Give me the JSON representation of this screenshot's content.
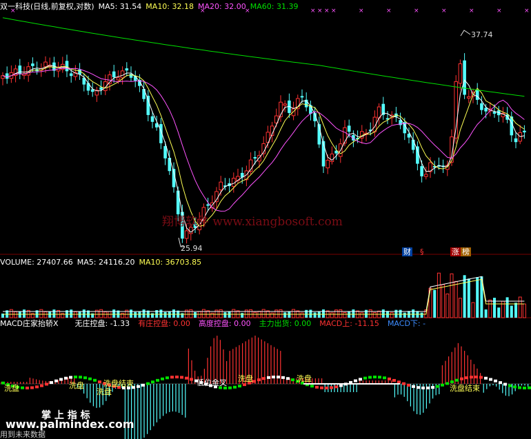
{
  "colors": {
    "up": "#ff3232",
    "down": "#54ffff",
    "ma5": "#ffffff",
    "ma10": "#ffff54",
    "ma20": "#ff54ff",
    "ma60": "#00e000",
    "macd_pos": "#ff3232",
    "macd_neg": "#54ffff",
    "grid": "#7a0000"
  },
  "price_panel": {
    "title": "双一科技(日线,前复权,对数)",
    "ma5": "MA5: 31.54",
    "ma10": "MA10: 32.18",
    "ma20": "MA20: 32.00",
    "ma60": "MA60: 31.39",
    "high_label": "37.74",
    "low_label": "25.94",
    "watermark": "翔博软件 www.xiangbosoft.com",
    "badge_cai": "财",
    "badge_s": "§",
    "badge_zhang": "涨",
    "badge_bang": "榜",
    "marker_glyph": "×"
  },
  "volume_panel": {
    "volume": "VOLUME: 27407.66",
    "ma5": "MA5: 24116.20",
    "ma10": "MA10: 36703.85"
  },
  "macd_panel": {
    "name": "MACD庄家抬轿X",
    "wuzhuang": "无庄控盘: -1.33",
    "youzhuang": "有庄控盘: 0.00",
    "gaodu": "高度控盘: 0.00",
    "zhuli": "主力出货: 0.00",
    "macd_up": "MACD上: -11.15",
    "macd_down": "MACD下: -",
    "label_xipan": "洗盘",
    "label_diwei": "低位金叉",
    "label_xipanjieshu": "洗盘结束",
    "footer": "用到未来数据",
    "logo_cn": "掌 上 指 标",
    "logo_url": "www.palmindex.com"
  }
}
